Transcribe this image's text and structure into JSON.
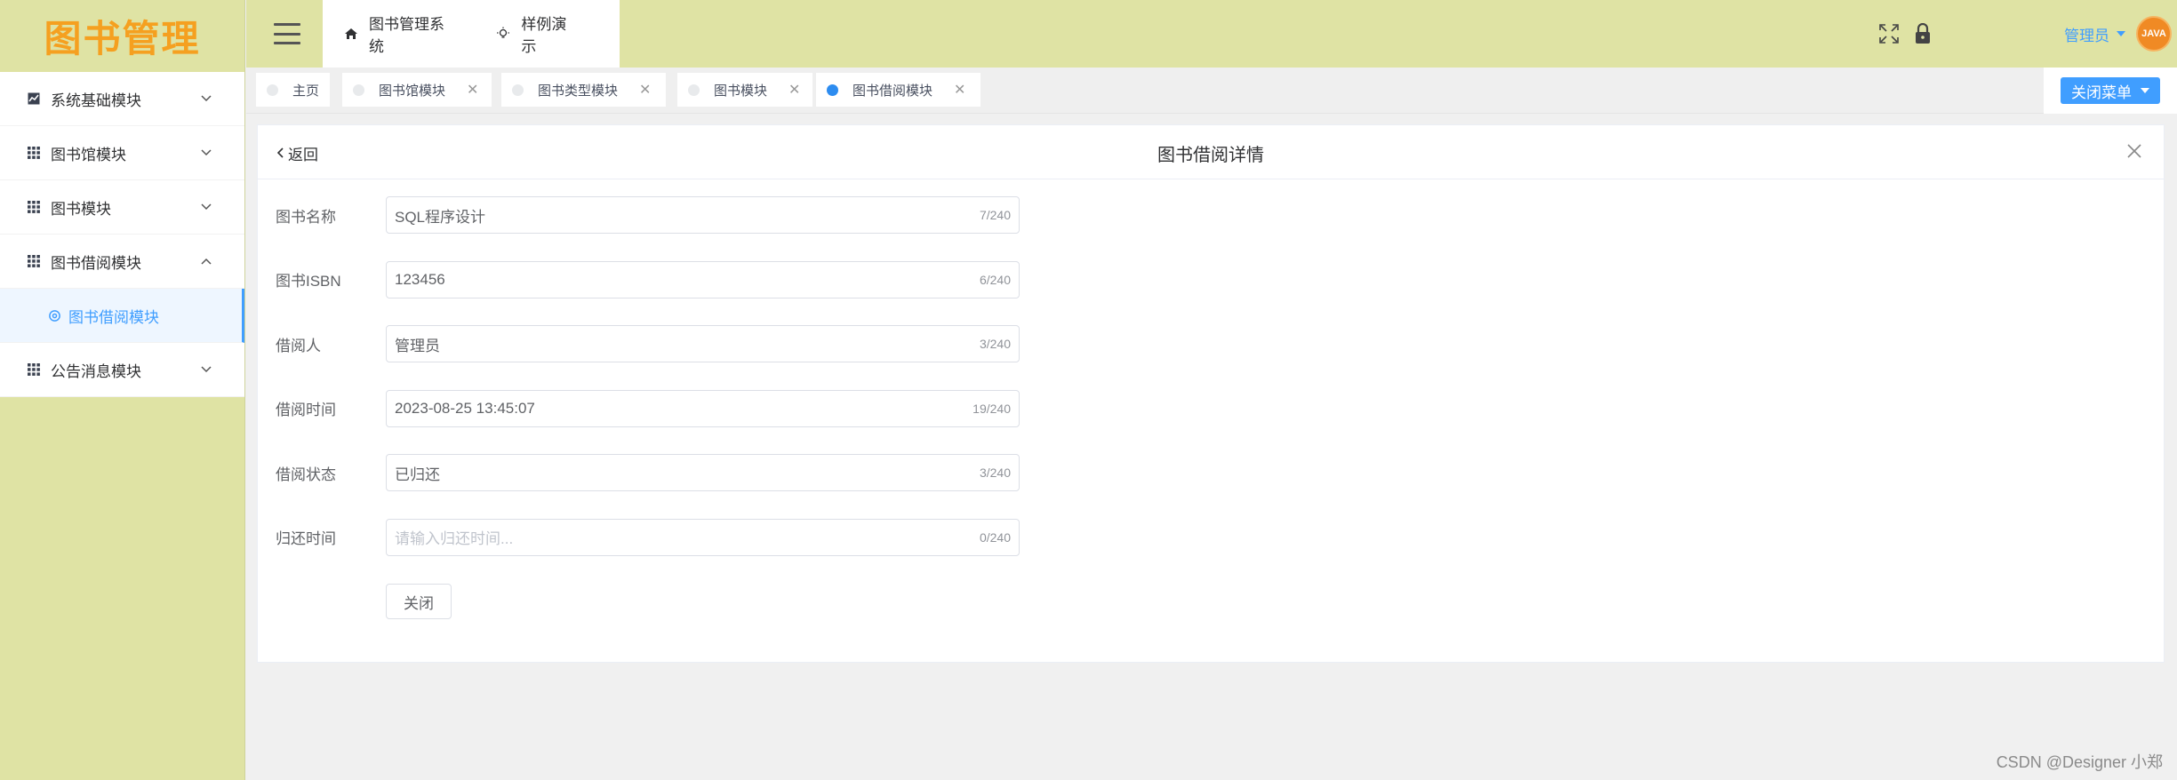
{
  "app": {
    "logo_text": "图书管理"
  },
  "sidebar": {
    "items": [
      {
        "label": "系统基础模块",
        "icon": "chart-icon",
        "expanded": false
      },
      {
        "label": "图书馆模块",
        "icon": "grid-icon",
        "expanded": false
      },
      {
        "label": "图书模块",
        "icon": "grid-icon",
        "expanded": false
      },
      {
        "label": "图书借阅模块",
        "icon": "grid-icon",
        "expanded": true
      },
      {
        "label": "公告消息模块",
        "icon": "grid-icon",
        "expanded": false
      }
    ],
    "sub_active": {
      "label": "图书借阅模块",
      "icon": "gear-icon"
    }
  },
  "header": {
    "nav": [
      {
        "label": "图书管理系统",
        "icon": "home-icon"
      },
      {
        "label": "样例演示",
        "icon": "bulb-icon"
      }
    ],
    "user_label": "管理员",
    "avatar_text": "JAVA"
  },
  "tabs": [
    {
      "label": "主页",
      "closable": false,
      "active": false
    },
    {
      "label": "图书馆模块",
      "closable": true,
      "active": false
    },
    {
      "label": "图书类型模块",
      "closable": true,
      "active": false
    },
    {
      "label": "图书模块",
      "closable": true,
      "active": false
    },
    {
      "label": "图书借阅模块",
      "closable": true,
      "active": true
    }
  ],
  "close_menu_label": "关闭菜单",
  "detail": {
    "back_label": "返回",
    "title": "图书借阅详情",
    "fields": [
      {
        "label": "图书名称",
        "value": "SQL程序设计",
        "count": "7/240"
      },
      {
        "label": "图书ISBN",
        "value": "123456",
        "count": "6/240"
      },
      {
        "label": "借阅人",
        "value": "管理员",
        "count": "3/240"
      },
      {
        "label": "借阅时间",
        "value": "2023-08-25 13:45:07",
        "count": "19/240"
      },
      {
        "label": "借阅状态",
        "value": "已归还",
        "count": "3/240"
      },
      {
        "label": "归还时间",
        "value": "",
        "placeholder": "请输入归还时间...",
        "count": "0/240"
      }
    ],
    "close_button": "关闭"
  },
  "watermark": "CSDN @Designer 小郑",
  "colors": {
    "accent": "#409eff",
    "header_bg": "#dfe3a4",
    "logo": "#f5a020"
  }
}
